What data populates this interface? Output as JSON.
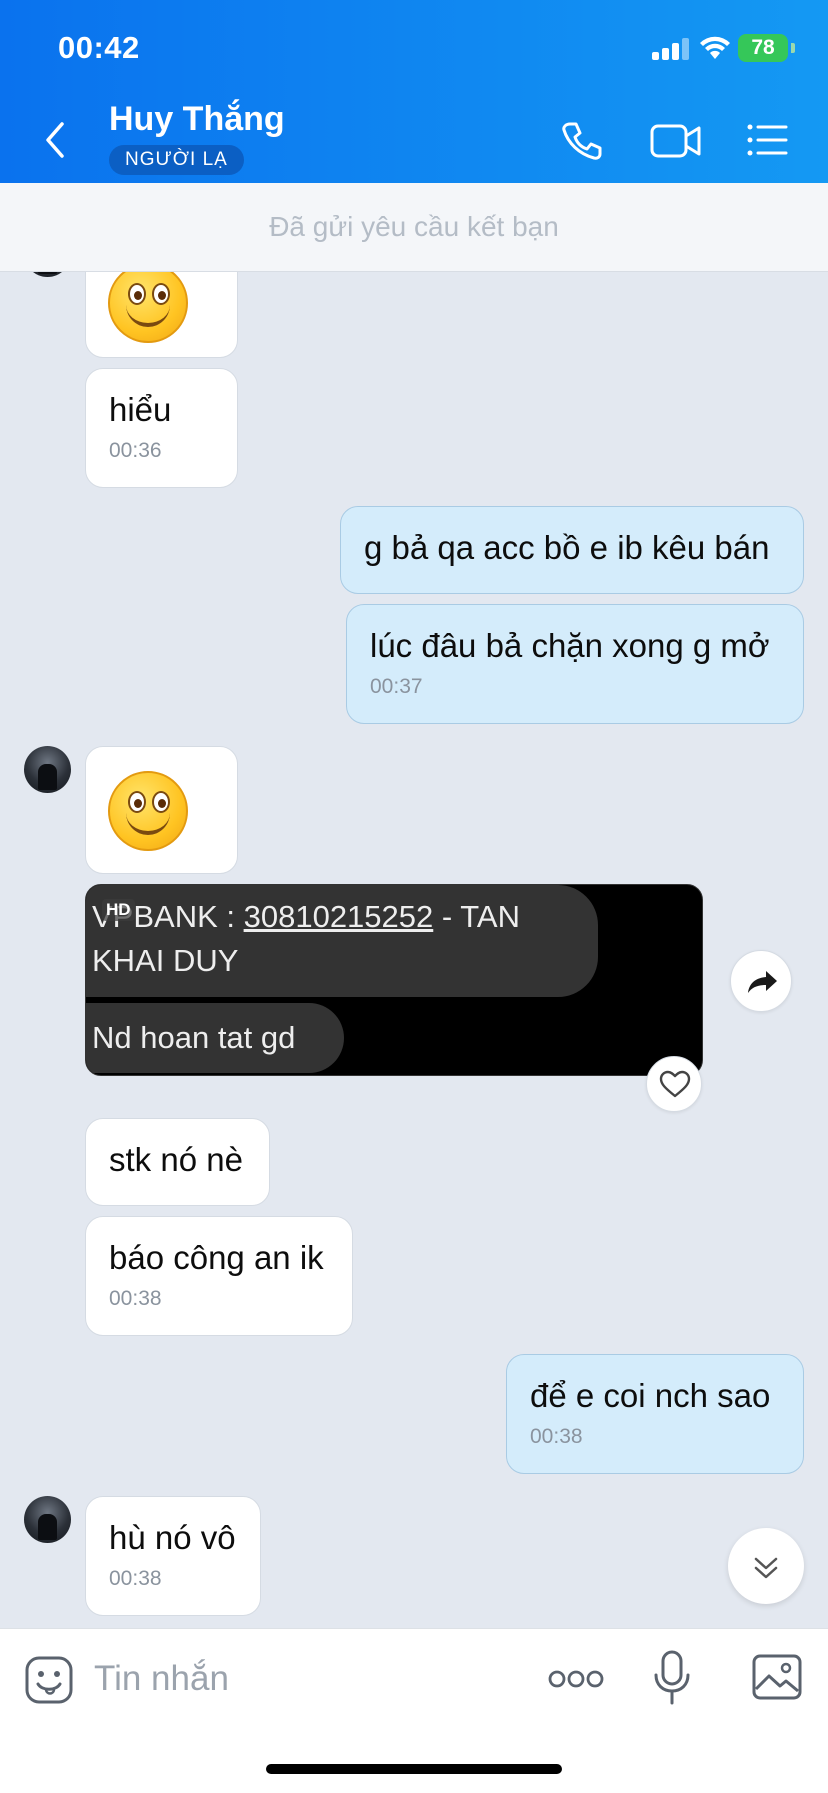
{
  "status_bar": {
    "time": "00:42",
    "battery": "78"
  },
  "header": {
    "contact_name": "Huy Thắng",
    "badge": "NGƯỜI LẠ"
  },
  "friend_request_text": "Đã gửi yêu cầu kết bạn",
  "messages": [
    {
      "text": "hiểu",
      "time": "00:36"
    },
    {
      "text": "g bả qa acc bồ e ib kêu bán"
    },
    {
      "text": "lúc đâu bả chặn xong g mở",
      "time": "00:37"
    },
    {
      "text": "stk nó nè"
    },
    {
      "text": "báo công an ik",
      "time": "00:38"
    },
    {
      "text": "để e coi nch sao",
      "time": "00:38"
    },
    {
      "text": "hù nó vô",
      "time": "00:38"
    }
  ],
  "image_message": {
    "hd_label": "HD",
    "line1_prefix": "VPBANK : ",
    "account_number": "30810215252",
    "line1_suffix": " - TAN",
    "line2": "KHAI DUY",
    "line3": "Nd hoan tat gd"
  },
  "composer": {
    "placeholder": "Tin nhắn"
  },
  "colors": {
    "header_start": "#0a72ee",
    "header_end": "#1499f3",
    "my_bubble": "#d4ecfb",
    "chat_bg": "#e3e8f0",
    "badge": "#0b5fc4",
    "battery": "#35c759"
  },
  "icons": [
    "back-icon",
    "phone-icon",
    "video-icon",
    "menu-icon",
    "forward-icon",
    "heart-icon",
    "scroll-down-icon",
    "sticker-icon",
    "more-icon",
    "mic-icon",
    "image-icon"
  ]
}
